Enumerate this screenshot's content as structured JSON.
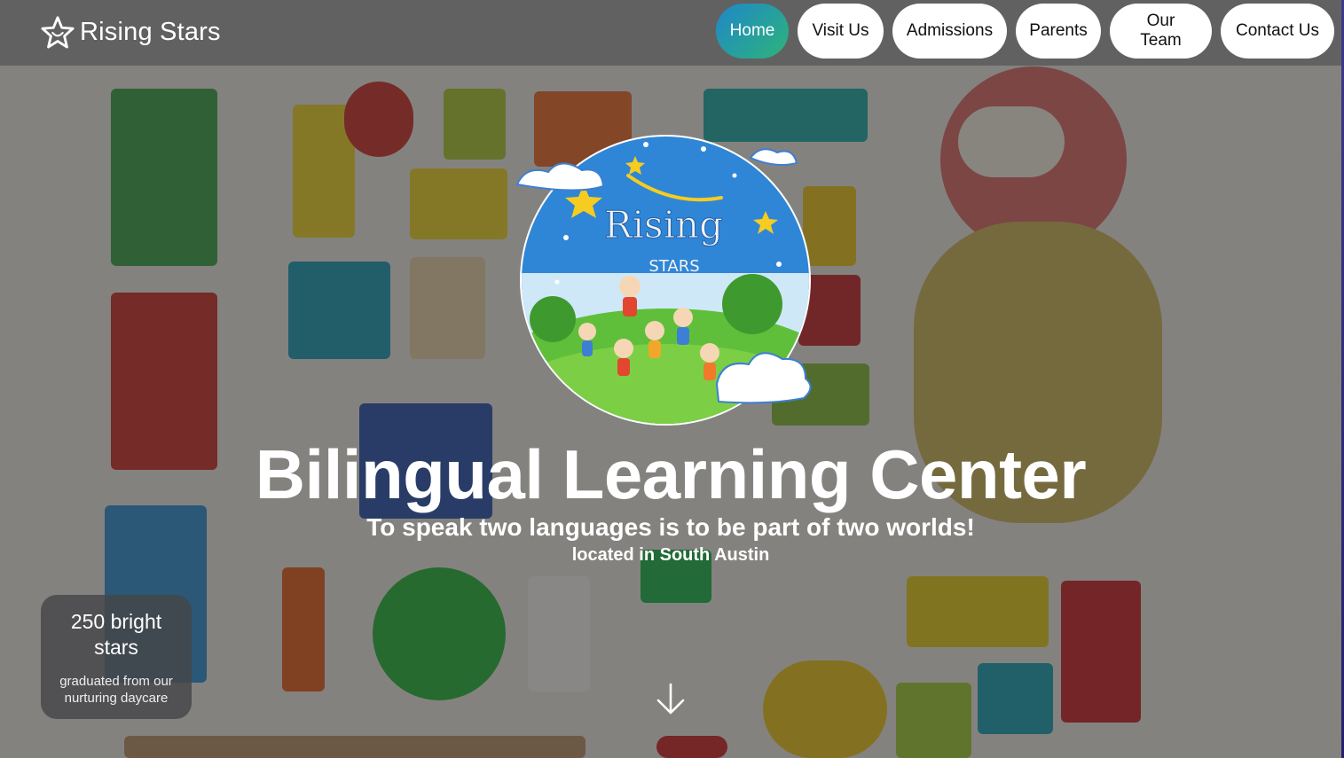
{
  "brand": {
    "name": "Rising Stars",
    "icon": "star-outline-icon"
  },
  "nav": {
    "items": [
      {
        "label": "Home",
        "active": true
      },
      {
        "label": "Visit Us",
        "active": false
      },
      {
        "label": "Admissions",
        "active": false
      },
      {
        "label": "Parents",
        "active": false
      },
      {
        "label": "Our Team",
        "active": false
      },
      {
        "label": "Contact Us",
        "active": false
      }
    ],
    "active_gradient": [
      "#1f87c9",
      "#2db47a"
    ]
  },
  "hero": {
    "logo_text_top": "Rising",
    "logo_text_bottom": "STARS",
    "title": "Bilingual Learning Center",
    "subtitle": "To speak two languages is to be part of two worlds!",
    "location": "located in South Austin"
  },
  "stat": {
    "number": "250 bright stars",
    "caption": "graduated from our nurturing daycare"
  },
  "scroll": {
    "icon": "arrow-down-icon"
  }
}
